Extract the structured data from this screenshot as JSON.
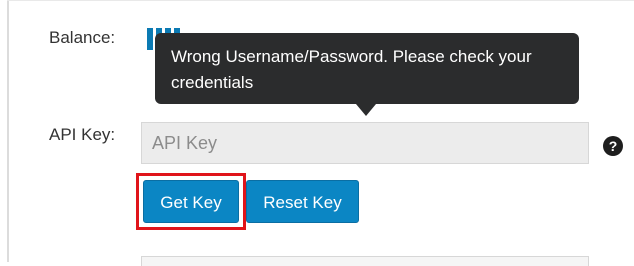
{
  "balance": {
    "label": "Balance:"
  },
  "tooltip": {
    "message": "Wrong Username/Password. Please check your credentials"
  },
  "api_key": {
    "label": "API Key:",
    "placeholder": "API Key",
    "value": ""
  },
  "buttons": {
    "get_key": "Get Key",
    "reset_key": "Reset Key"
  },
  "help_icon": {
    "glyph": "?",
    "icon": "question-circle-icon"
  },
  "colors": {
    "button_blue": "#0b86c4",
    "highlight_red": "#e0141a",
    "tooltip_bg": "#2b2c2d"
  }
}
